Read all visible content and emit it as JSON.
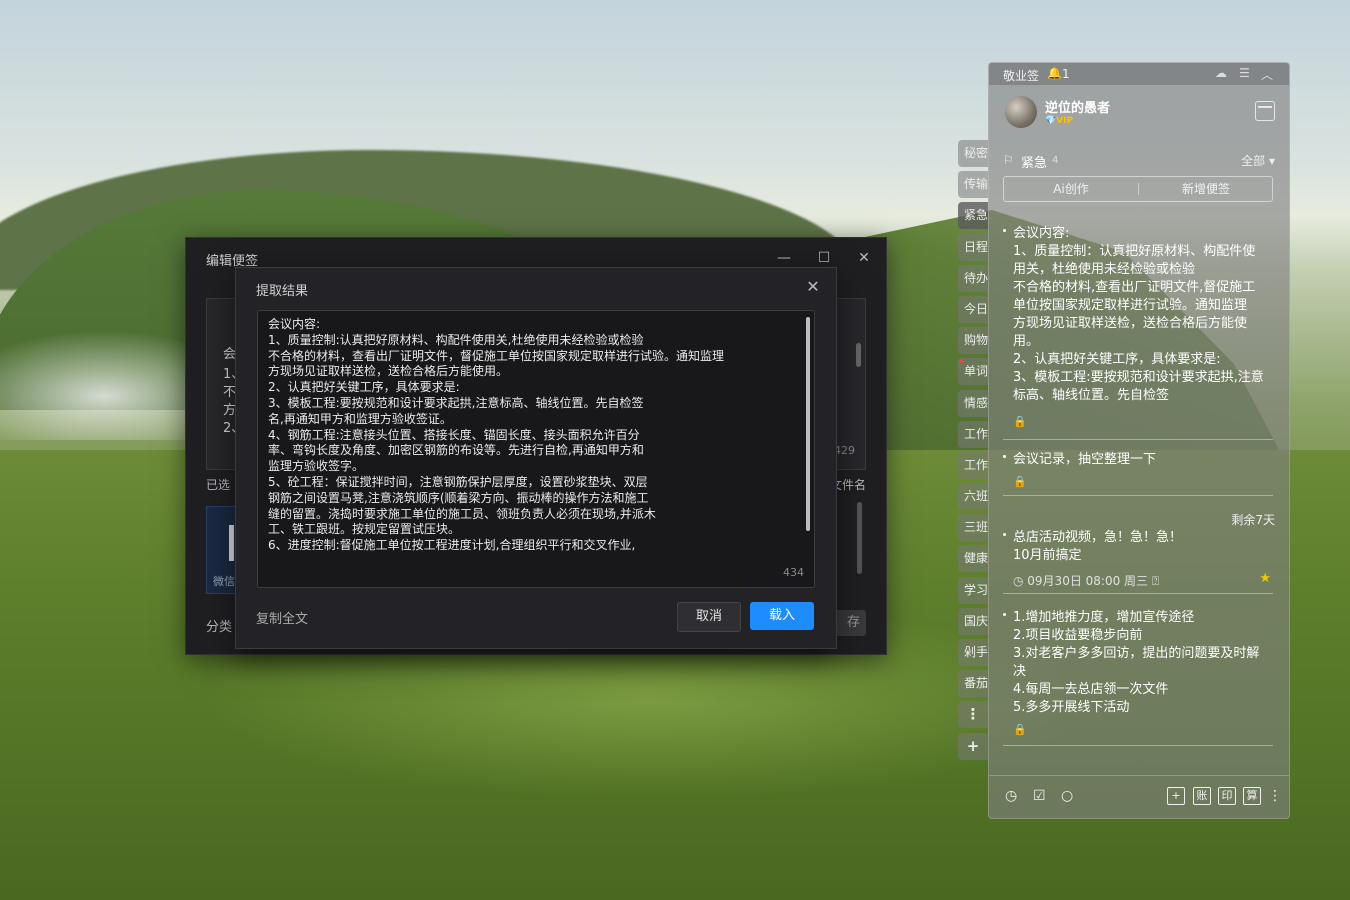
{
  "editor": {
    "title": "编辑便签",
    "minimize": "—",
    "maximize": "☐",
    "close": "✕",
    "content_lines": [
      "会",
      "1、",
      "不",
      "方",
      "2、"
    ],
    "count": "429",
    "selected_label": "已选",
    "filename_label": "文件名",
    "thumb_label": "微信",
    "category_label": "分类",
    "save_label": "存"
  },
  "dialog": {
    "title": "提取结果",
    "close": "✕",
    "lines": [
      "会议内容:",
      "1、质量控制:认真把好原材料、构配件使用关,杜绝使用未经检验或检验",
      "不合格的材料，查看出厂证明文件，督促施工单位按国家规定取样进行试验。通知监理",
      "方现场见证取样送检，送检合格后方能使用。",
      "2、认真把好关键工序，具体要求是:",
      "3、模板工程:要按规范和设计要求起拱,注意标高、轴线位置。先自检签",
      "名,再通知甲方和监理方验收签证。",
      "4、钢筋工程:注意接头位置、搭接长度、锚固长度、接头面积允许百分",
      "率、弯钩长度及角度、加密区钢筋的布设等。先进行自检,再通知甲方和",
      "监理方验收签字。",
      "5、砼工程：保证搅拌时间，注意钢筋保护层厚度，设置砂浆垫块、双层",
      "钢筋之间设置马凳,注意浇筑顺序(顺着梁方向、振动棒的操作方法和施工",
      "缝的留置。浇捣时要求施工单位的施工员、领班负责人必须在现场,并派木",
      "工、铁工跟班。按规定留置试压块。",
      "6、进度控制:督促施工单位按工程进度计划,合理组织平行和交叉作业,"
    ],
    "count": "434",
    "copy_all": "复制全文",
    "cancel": "取消",
    "load": "载入"
  },
  "side_tabs": [
    "秘密",
    "传输",
    "紧急",
    "日程",
    "待办",
    "今日",
    "购物",
    "单词",
    "情感",
    "工作",
    "工作",
    "六班",
    "三班",
    "健康",
    "学习",
    "国庆",
    "剁手",
    "番茄"
  ],
  "side_more": "⋮",
  "side_add": "+",
  "panel": {
    "app_name": "敬业签",
    "bell_icon": "🔔",
    "notification_count": "1",
    "top_icons": [
      "☁",
      "☰",
      "︿"
    ],
    "user_name": "逆位的愚者",
    "vip": "💎VIP",
    "category": {
      "flag": "⚐",
      "name": "紧急",
      "count": "4",
      "filter": "全部 ▾"
    },
    "ai_create": "Ai创作",
    "new_note": "新增便签",
    "notes": [
      {
        "lines": [
          "会议内容:",
          "1、质量控制：认真把好原材料、构配件使",
          "用关，杜绝使用未经检验或检验",
          "不合格的材料,查看出厂证明文件,督促施工",
          "单位按国家规定取样进行试验。通知监理",
          "方现场见证取样送检，送检合格后方能使",
          "用。",
          "2、认真把好关键工序，具体要求是:",
          "3、模板工程:要按规范和设计要求起拱,注意",
          "标高、轴线位置。先自检签"
        ]
      },
      {
        "lines": [
          "会议记录，抽空整理一下"
        ]
      },
      {
        "lines": [
          "总店活动视频，急！急！急！",
          "10月前搞定"
        ],
        "remaining": "剩余7天",
        "meta": "◷ 09月30日 08:00 周三 ⍰"
      },
      {
        "lines": [
          "1.增加地推力度，增加宣传途径",
          "2.项目收益要稳步向前",
          "3.对老客户多多回访，提出的问题要及时解",
          "决",
          "4.每周一去总店领一次文件",
          "5.多多开展线下活动"
        ]
      }
    ],
    "lock_icon": "🔒",
    "star_icon": "★",
    "bottom_left_icons": [
      "◷",
      "☑",
      "○"
    ],
    "bottom_right_icons": [
      "+",
      "账",
      "印",
      "算"
    ],
    "bottom_more": "⋮"
  }
}
